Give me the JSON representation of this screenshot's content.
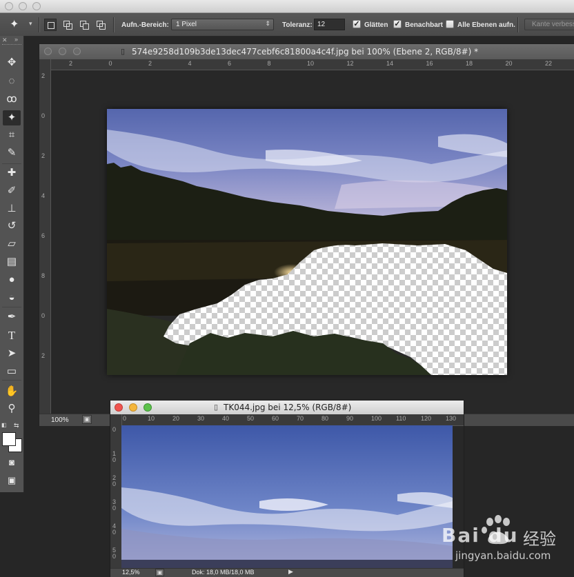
{
  "options_bar": {
    "sample_size_label": "Aufn.-Bereich:",
    "sample_size_value": "1 Pixel",
    "tolerance_label": "Toleranz:",
    "tolerance_value": "12",
    "antialias_label": "Glätten",
    "antialias_checked": true,
    "contiguous_label": "Benachbart",
    "contiguous_checked": true,
    "all_layers_label": "Alle Ebenen aufn.",
    "all_layers_checked": false,
    "refine_edge_label": "Kante verbess"
  },
  "toolbox": {
    "tools": [
      "move-tool",
      "marquee-tool",
      "lasso-tool",
      "magic-wand-tool",
      "crop-tool",
      "eyedropper-tool",
      "healing-brush-tool",
      "brush-tool",
      "clone-stamp-tool",
      "history-brush-tool",
      "eraser-tool",
      "gradient-tool",
      "blur-tool",
      "dodge-tool",
      "pen-tool",
      "type-tool",
      "path-selection-tool",
      "rectangle-tool",
      "hand-tool",
      "zoom-tool"
    ]
  },
  "doc1": {
    "title": "574e9258d109b3de13dec477cebf6c81800a4c4f.jpg bei 100% (Ebene 2, RGB/8#) *",
    "zoom": "100%",
    "ruler_top": [
      "2",
      "0",
      "2",
      "4",
      "6",
      "8",
      "10",
      "12",
      "14",
      "16",
      "18",
      "20",
      "22"
    ],
    "ruler_left": [
      "2",
      "0",
      "2",
      "4",
      "6",
      "8",
      "0",
      "2"
    ]
  },
  "doc2": {
    "title": "TK044.jpg bei 12,5% (RGB/8#)",
    "zoom": "12,5%",
    "doc_size": "Dok: 18,0 MB/18,0 MB",
    "ruler_top": [
      "0",
      "10",
      "20",
      "30",
      "40",
      "50",
      "60",
      "70",
      "80",
      "90",
      "100",
      "110",
      "120",
      "130"
    ],
    "ruler_left": [
      "0",
      "1\n0",
      "2\n0",
      "3\n0",
      "4\n0",
      "5\n0"
    ]
  },
  "watermark": {
    "brand": "Bai du",
    "cn": "经验",
    "url": "jingyan.baidu.com"
  },
  "colors": {
    "panel": "#535353",
    "workspace": "#262626",
    "sky": "#5a6fb6",
    "trees": "#1a1a12"
  }
}
